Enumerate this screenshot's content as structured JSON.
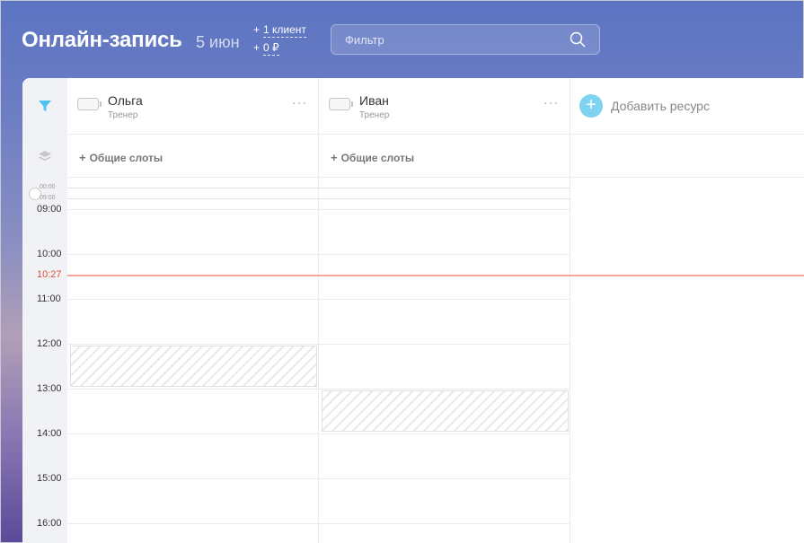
{
  "header": {
    "title": "Онлайн-запись",
    "date": "5 июн",
    "stats": {
      "clients_prefix": "+",
      "clients": "1 клиент",
      "money_prefix": "+",
      "money": "0 ₽"
    },
    "filter_placeholder": "Фильтр"
  },
  "resources": [
    {
      "name": "Ольга",
      "role": "Тренер",
      "menu": "···"
    },
    {
      "name": "Иван",
      "role": "Тренер",
      "menu": "···"
    }
  ],
  "add_resource": {
    "icon": "+",
    "label": "Добавить ресурс"
  },
  "shared_slots": {
    "icon": "+",
    "label": "Общие слоты"
  },
  "timeline": {
    "compact_times": [
      "00:00",
      "09:00"
    ],
    "hours": [
      "09:00",
      "10:00",
      "11:00",
      "12:00",
      "13:00",
      "14:00",
      "15:00",
      "16:00"
    ],
    "current_time": "10:27"
  },
  "busy_blocks": [
    {
      "resource": "Ольга",
      "start": "12:00",
      "end": "13:00"
    },
    {
      "resource": "Иван",
      "start": "13:00",
      "end": "14:00"
    }
  ],
  "icons": {
    "search": "search-icon",
    "filter": "filter-icon",
    "layers": "layers-icon",
    "battery": "battery-icon"
  },
  "colors": {
    "accent": "#4ec3ef",
    "now_line": "#f5a49a",
    "now_label": "#e04c3c"
  }
}
